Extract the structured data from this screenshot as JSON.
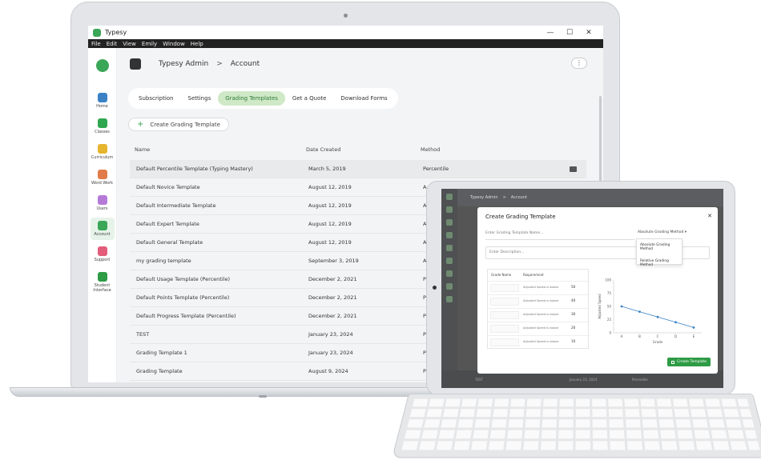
{
  "app": {
    "title": "Typesy"
  },
  "window_controls": {
    "minimize": "—",
    "maximize": "☐",
    "close": "✕"
  },
  "menu": [
    "File",
    "Edit",
    "View",
    "Emily",
    "Window",
    "Help"
  ],
  "sidebar": {
    "items": [
      {
        "label": "Home",
        "icon": "home-icon",
        "color": "#3b82c4"
      },
      {
        "label": "Classes",
        "icon": "classes-icon",
        "color": "#2fa64f"
      },
      {
        "label": "Curriculum",
        "icon": "curriculum-icon",
        "color": "#e5b52e"
      },
      {
        "label": "Word Work",
        "icon": "word-work-icon",
        "color": "#e27b4a"
      },
      {
        "label": "Users",
        "icon": "users-icon",
        "color": "#b57ad8"
      },
      {
        "label": "Account",
        "icon": "account-icon",
        "color": "#3aa657",
        "active": true
      },
      {
        "label": "Support",
        "icon": "support-icon",
        "color": "#e35c7a"
      },
      {
        "label": "Student Interface",
        "icon": "student-interface-icon",
        "color": "#2e9b45"
      }
    ]
  },
  "header": {
    "admin": "Typesy Admin",
    "separator": ">",
    "page": "Account",
    "kebab": "⋮"
  },
  "tabs": [
    {
      "label": "Subscription"
    },
    {
      "label": "Settings"
    },
    {
      "label": "Grading Templates",
      "active": true
    },
    {
      "label": "Get a Quote"
    },
    {
      "label": "Download Forms"
    }
  ],
  "create_button": {
    "plus": "+",
    "label": "Create Grading Template"
  },
  "table": {
    "columns": [
      "Name",
      "Date Created",
      "Method"
    ],
    "rows": [
      {
        "name": "Default Percentile Template (Typing Mastery)",
        "date": "March 5, 2019",
        "method": "Percentile"
      },
      {
        "name": "Default Novice Template",
        "date": "August 12, 2019",
        "method": "A"
      },
      {
        "name": "Default Intermediate Template",
        "date": "August 12, 2019",
        "method": "A"
      },
      {
        "name": "Default Expert Template",
        "date": "August 12, 2019",
        "method": "A"
      },
      {
        "name": "Default General Template",
        "date": "August 12, 2019",
        "method": "A"
      },
      {
        "name": "my grading template",
        "date": "September 3, 2019",
        "method": "A"
      },
      {
        "name": "Default Usage Template (Percentile)",
        "date": "December 2, 2021",
        "method": "P"
      },
      {
        "name": "Default Points Template (Percentile)",
        "date": "December 2, 2021",
        "method": "P"
      },
      {
        "name": "Default Progress Template (Percentile)",
        "date": "December 2, 2021",
        "method": "P"
      },
      {
        "name": "TEST",
        "date": "January 23, 2024",
        "method": "P"
      },
      {
        "name": "Grading Template 1",
        "date": "January 23, 2024",
        "method": "P"
      },
      {
        "name": "Grading Template",
        "date": "August 9, 2024",
        "method": "P"
      }
    ]
  },
  "tablet": {
    "header": {
      "admin": "Typesy Admin",
      "separator": ">",
      "page": "Account"
    },
    "footer_row": {
      "name": "TEST",
      "date": "January 23, 2024",
      "method": "Percentile"
    },
    "modal": {
      "title": "Create Grading Template",
      "close": "✕",
      "name_placeholder": "Enter Grading Template Name...",
      "method_select": "Absolute Grading Method ▾",
      "method_options": [
        "Absolute Grading Method",
        "Relative Grading Method"
      ],
      "description_placeholder": "Enter Description...",
      "grade_table": {
        "columns": [
          "Grade Name",
          "Requirement"
        ],
        "rows": [
          {
            "requirement": "Adjusted Speed is above",
            "value": "50"
          },
          {
            "requirement": "Adjusted Speed is above",
            "value": "40"
          },
          {
            "requirement": "Adjusted Speed is above",
            "value": "30"
          },
          {
            "requirement": "Adjusted Speed is above",
            "value": "20"
          },
          {
            "requirement": "Adjusted Speed is above",
            "value": "10"
          }
        ]
      },
      "create_button": "Create Template"
    }
  },
  "chart_data": {
    "type": "line",
    "x": [
      "A",
      "B",
      "C",
      "D",
      "E"
    ],
    "series": [
      {
        "values": [
          50,
          40,
          30,
          20,
          10
        ]
      }
    ],
    "ylim": [
      0,
      100
    ],
    "yticks": [
      0,
      25,
      50,
      75,
      100
    ],
    "xlabel": "Grade",
    "ylabel": "Adjusted Speed",
    "color": "#3b82c4"
  }
}
